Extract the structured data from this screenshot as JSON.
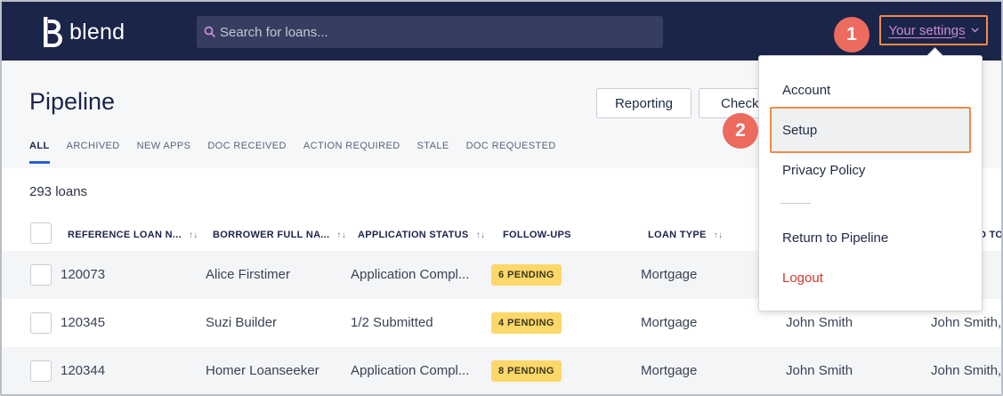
{
  "app": {
    "brand": "blend",
    "search_placeholder": "Search for loans...",
    "settings_label": "Your settings"
  },
  "annotations": {
    "step1": "1",
    "step2": "2"
  },
  "header": {
    "title": "Pipeline",
    "buttons": {
      "reporting": "Reporting",
      "check": "Check r"
    },
    "tabs": [
      "ALL",
      "ARCHIVED",
      "NEW APPS",
      "DOC RECEIVED",
      "ACTION REQUIRED",
      "STALE",
      "DOC REQUESTED"
    ]
  },
  "table": {
    "count": "293 loans",
    "columns": [
      "REFERENCE LOAN N...",
      "BORROWER FULL NA...",
      "APPLICATION STATUS",
      "FOLLOW-UPS",
      "LOAN TYPE",
      "D TO"
    ],
    "rows": [
      {
        "ref": "120073",
        "borrower": "Alice Firstimer",
        "status": "Application Compl...",
        "followups": "6 PENDING",
        "type": "Mortgage",
        "officer": "",
        "assigned": ""
      },
      {
        "ref": "120345",
        "borrower": "Suzi Builder",
        "status": "1/2 Submitted",
        "followups": "4 PENDING",
        "type": "Mortgage",
        "officer": "John Smith",
        "assigned": "John Smith,"
      },
      {
        "ref": "120344",
        "borrower": "Homer Loanseeker",
        "status": "Application Compl...",
        "followups": "8 PENDING",
        "type": "Mortgage",
        "officer": "John Smith",
        "assigned": "John Smith,"
      }
    ]
  },
  "dropdown": {
    "items": {
      "account": "Account",
      "setup": "Setup",
      "privacy": "Privacy Policy",
      "return": "Return to Pipeline",
      "logout": "Logout"
    }
  },
  "colors": {
    "nav_bg": "#1b2449",
    "accent_tab": "#2a5bd7",
    "highlight": "#f08b4b",
    "badge": "#ec6a5e",
    "pill": "#fcd86a",
    "logout": "#d0342c",
    "settings_text": "#c98bd6"
  }
}
